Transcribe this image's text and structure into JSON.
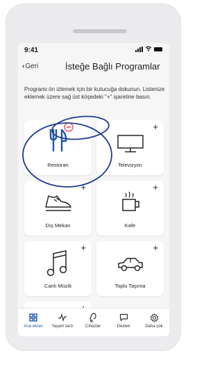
{
  "status": {
    "time": "9:41"
  },
  "nav": {
    "back_label": "Geri",
    "title": "İsteğe Bağlı Programlar"
  },
  "intro_text": "Programı ön izlemek için bir kutucuğa dokunun. Listenize eklemek üzere sağ üst köşedeki \"+\" işaretine basın.",
  "programs": [
    {
      "label": "Restoran",
      "icon": "fork-knife-icon",
      "action": "remove"
    },
    {
      "label": "Televizyon",
      "icon": "tv-icon",
      "action": "add"
    },
    {
      "label": "Dış Mekan",
      "icon": "shoe-icon",
      "action": "add"
    },
    {
      "label": "Kafe",
      "icon": "coffee-cup-icon",
      "action": "add"
    },
    {
      "label": "Canlı Müzik",
      "icon": "music-note-icon",
      "action": "add"
    },
    {
      "label": "Toplu Taşıma",
      "icon": "car-icon",
      "action": "add"
    },
    {
      "label": "",
      "icon": "",
      "action": "add"
    }
  ],
  "add_symbol": "+",
  "tabs": [
    {
      "label": "Ana ekran",
      "icon": "home-grid-icon",
      "active": true
    },
    {
      "label": "Yaşam tarzı",
      "icon": "activity-icon",
      "active": false
    },
    {
      "label": "Cihazlar",
      "icon": "hearing-aid-icon",
      "active": false
    },
    {
      "label": "Destek",
      "icon": "chat-icon",
      "active": false
    },
    {
      "label": "Daha çok",
      "icon": "gear-icon",
      "active": false
    }
  ],
  "colors": {
    "accent": "#1b57a8",
    "remove": "#e0485a",
    "annotation": "#1f3b8f"
  }
}
